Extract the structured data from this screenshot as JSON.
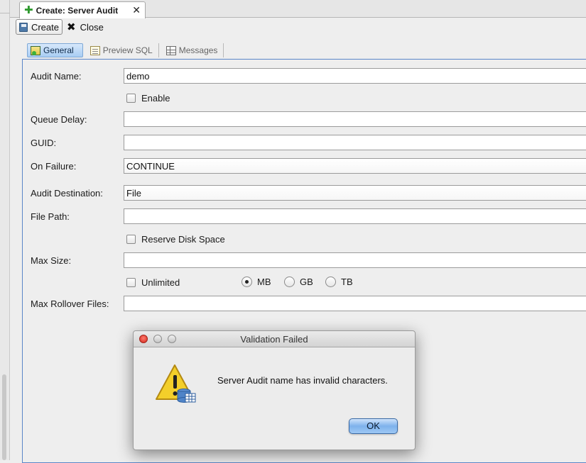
{
  "document_tab": {
    "title": "Create: Server Audit",
    "close_glyph": "✕"
  },
  "toolbar": {
    "create_label": "Create",
    "close_label": "Close"
  },
  "subtabs": [
    {
      "label": "General",
      "icon": "general-icon",
      "active": true
    },
    {
      "label": "Preview SQL",
      "icon": "sql-icon",
      "active": false
    },
    {
      "label": "Messages",
      "icon": "grid-icon",
      "active": false
    }
  ],
  "form": {
    "audit_name": {
      "label": "Audit Name:",
      "value": "demo"
    },
    "enable": {
      "label": "Enable",
      "checked": false
    },
    "queue_delay": {
      "label": "Queue Delay:",
      "value": ""
    },
    "guid": {
      "label": "GUID:",
      "value": ""
    },
    "on_failure": {
      "label": "On Failure:",
      "value": "CONTINUE"
    },
    "audit_destination": {
      "label": "Audit Destination:",
      "value": "File"
    },
    "file_path": {
      "label": "File Path:",
      "value": ""
    },
    "reserve_disk_space": {
      "label": "Reserve Disk Space",
      "checked": false
    },
    "max_size": {
      "label": "Max Size:",
      "value": ""
    },
    "unlimited": {
      "label": "Unlimited",
      "checked": false
    },
    "size_units": [
      {
        "label": "MB",
        "selected": true
      },
      {
        "label": "GB",
        "selected": false
      },
      {
        "label": "TB",
        "selected": false
      }
    ],
    "max_rollover_files": {
      "label": "Max Rollover Files:",
      "value": ""
    }
  },
  "dialog": {
    "title": "Validation Failed",
    "message": "Server Audit name has invalid characters.",
    "ok_label": "OK",
    "icon": "warning-database-icon"
  },
  "colors": {
    "accent": "#5a86c8",
    "ok_button": "#7eb2ec",
    "close_red": "#d3271c"
  }
}
